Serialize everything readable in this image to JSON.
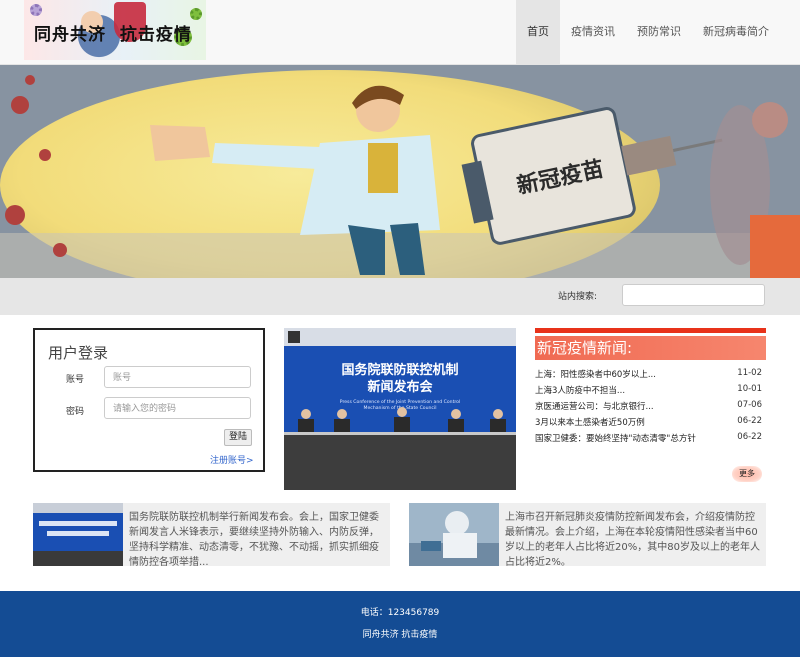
{
  "header": {
    "logo_text": "同舟共济  抗击疫情",
    "nav": [
      {
        "label": "首页",
        "active": true
      },
      {
        "label": "疫情资讯",
        "active": false
      },
      {
        "label": "预防常识",
        "active": false
      },
      {
        "label": "新冠病毒简介",
        "active": false
      }
    ]
  },
  "banner": {
    "syringe_text": "新冠疫苗"
  },
  "search": {
    "label": "站内搜索:",
    "value": ""
  },
  "login": {
    "title": "用户登录",
    "account_label": "账号",
    "account_placeholder": "账号",
    "password_label": "密码",
    "password_placeholder": "请输入您的密码",
    "login_button": "登陆",
    "register_link": "注册账号>"
  },
  "photo": {
    "banner_title_line1": "国务院联防联控机制",
    "banner_title_line2": "新闻发布会",
    "banner_subtitle_line1": "Press Conference of the Joint Prevention and Control",
    "banner_subtitle_line2": "Mechanism of the State Council"
  },
  "news": {
    "title": "新冠疫情新闻:",
    "items": [
      {
        "title": "上海：阳性感染者中60岁以上...",
        "date": "11-02"
      },
      {
        "title": "上海3人防疫中不担当...",
        "date": "10-01"
      },
      {
        "title": "京医通运营公司：与北京银行...",
        "date": "07-06"
      },
      {
        "title": "3月以来本土感染者近50万例",
        "date": "06-22"
      },
      {
        "title": "国家卫健委：要始终坚持\"动态清零\"总方针",
        "date": "06-22"
      }
    ],
    "more": "更多"
  },
  "articles": [
    {
      "text": "国务院联防联控机制举行新闻发布会。会上，国家卫健委新闻发言人米锋表示，要继续坚持外防输入、内防反弹，坚持科学精准、动态清零，不犹豫、不动摇，抓实抓细疫情防控各项举措..."
    },
    {
      "text": "上海市召开新冠肺炎疫情防控新闻发布会，介绍疫情防控最新情况。会上介绍，上海在本轮疫情阳性感染者当中60岁以上的老年人占比将近20%，其中80岁及以上的老年人占比将近2%。"
    }
  ],
  "footer": {
    "phone": "电话：123456789",
    "slogan": "同舟共济 抗击疫情"
  },
  "colors": {
    "footer_bg": "#144c94",
    "news_bar": "#e8321a",
    "news_head": "#f06a52"
  }
}
